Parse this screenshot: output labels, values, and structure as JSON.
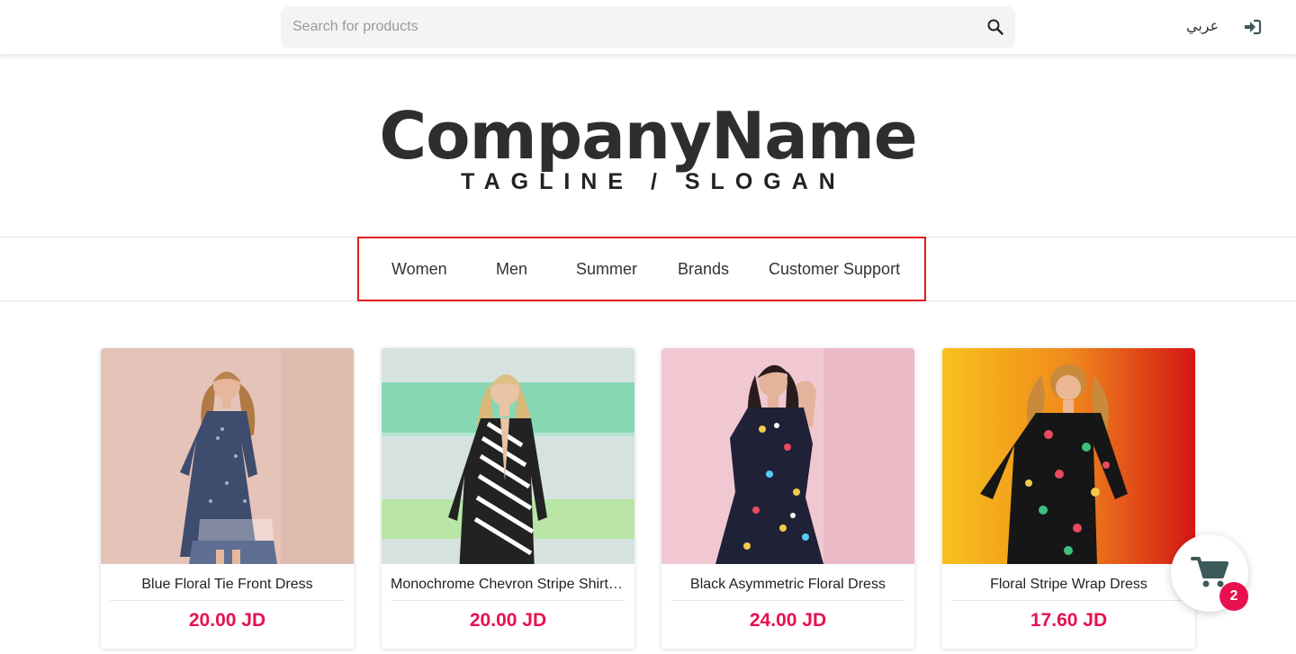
{
  "header": {
    "search": {
      "placeholder": "Search for products",
      "value": ""
    },
    "language_label": "عربي"
  },
  "logo": {
    "name": "CompanyName",
    "tagline": "TAGLINE / SLOGAN"
  },
  "nav": {
    "items": [
      {
        "label": "Women"
      },
      {
        "label": "Men"
      },
      {
        "label": "Summer"
      },
      {
        "label": "Brands"
      },
      {
        "label": "Customer Support"
      }
    ]
  },
  "products": [
    {
      "name": "Blue Floral Tie Front Dress",
      "price": "20.00 JD"
    },
    {
      "name": "Monochrome Chevron Stripe Shirt Dress",
      "price": "20.00 JD"
    },
    {
      "name": "Black Asymmetric Floral Dress",
      "price": "24.00 JD"
    },
    {
      "name": "Floral Stripe Wrap Dress",
      "price": "17.60 JD"
    }
  ],
  "cart": {
    "count": "2"
  },
  "colors": {
    "accent": "#e8114f",
    "highlight_border": "#e31b1b",
    "icon": "#3d5a5a"
  },
  "icons": {
    "search": "search-icon",
    "login": "sign-in-icon",
    "cart": "shopping-cart-icon"
  }
}
